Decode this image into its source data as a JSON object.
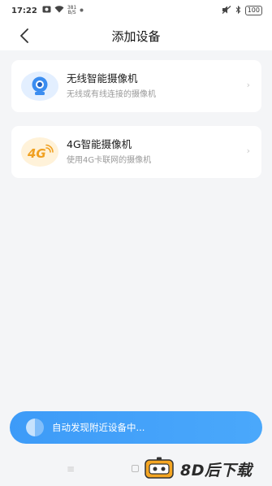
{
  "status_bar": {
    "time": "17:22",
    "net_speed_value": "381",
    "net_speed_unit": "B/S",
    "battery": "100"
  },
  "header": {
    "title": "添加设备"
  },
  "devices": [
    {
      "name": "无线智能摄像机",
      "description": "无线或有线连接的摄像机",
      "icon": "wireless-camera-icon"
    },
    {
      "name": "4G智能摄像机",
      "description": "使用4G卡联网的摄像机",
      "icon": "4g-camera-icon",
      "icon_text": "4G"
    }
  ],
  "discover": {
    "label": "自动发现附近设备中..."
  },
  "watermark": {
    "text": "8D后下载"
  },
  "colors": {
    "accent": "#3d9bf8",
    "camera_blue": "#3b8df0",
    "four_g_orange": "#f0a020"
  }
}
